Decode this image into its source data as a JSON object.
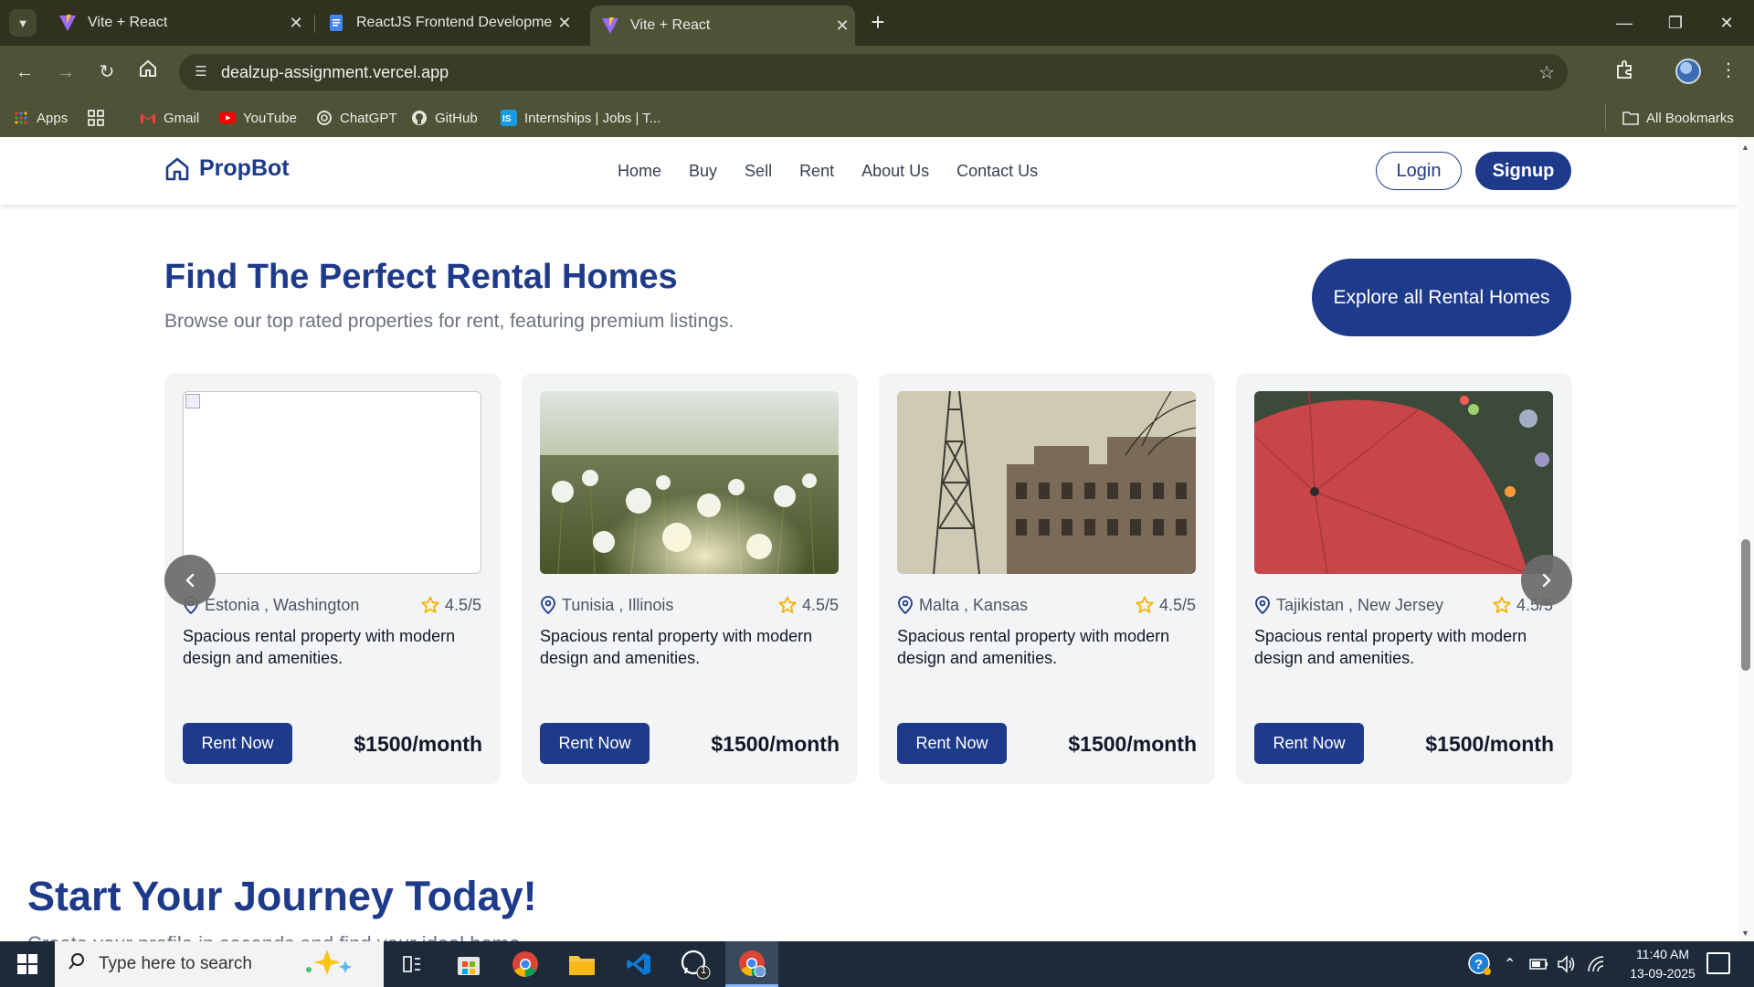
{
  "browser": {
    "tabs": [
      {
        "title": "Vite + React",
        "active": false
      },
      {
        "title": "ReactJS Frontend Development",
        "active": false
      },
      {
        "title": "Vite + React",
        "active": true
      }
    ],
    "url": "dealzup-assignment.vercel.app",
    "bookmarks": [
      {
        "label": "Apps",
        "icon": "apps-grid-icon"
      },
      {
        "label": "",
        "icon": "tab-groups-icon"
      },
      {
        "label": "Gmail",
        "icon": "gmail-icon"
      },
      {
        "label": "YouTube",
        "icon": "youtube-icon"
      },
      {
        "label": "ChatGPT",
        "icon": "chatgpt-icon"
      },
      {
        "label": "GitHub",
        "icon": "github-icon"
      },
      {
        "label": "Internships | Jobs | T...",
        "icon": "internshala-icon"
      }
    ],
    "all_bookmarks": "All Bookmarks"
  },
  "site": {
    "brand": "PropBot",
    "nav": [
      "Home",
      "Buy",
      "Sell",
      "Rent",
      "About Us",
      "Contact Us"
    ],
    "login": "Login",
    "signup": "Signup"
  },
  "rental": {
    "title": "Find The Perfect Rental Homes",
    "subtitle": "Browse our top rated properties for rent, featuring premium listings.",
    "explore": "Explore all Rental Homes",
    "cards": [
      {
        "location": "Estonia , Washington",
        "rating": "4.5/5",
        "description": "Spacious rental property with modern design and amenities.",
        "button": "Rent Now",
        "price": "$1500/month",
        "image": "broken-image"
      },
      {
        "location": "Tunisia , Illinois",
        "rating": "4.5/5",
        "description": "Spacious rental property with modern design and amenities.",
        "button": "Rent Now",
        "price": "$1500/month",
        "image": "dandelion-field"
      },
      {
        "location": "Malta , Kansas",
        "rating": "4.5/5",
        "description": "Spacious rental property with modern design and amenities.",
        "button": "Rent Now",
        "price": "$1500/month",
        "image": "eiffel-tower-street"
      },
      {
        "location": "Tajikistan , New Jersey",
        "rating": "4.5/5",
        "description": "Spacious rental property with modern design and amenities.",
        "button": "Rent Now",
        "price": "$1500/month",
        "image": "red-umbrella"
      }
    ]
  },
  "journey": {
    "title": "Start Your Journey Today!",
    "subtitle": "Create your profile in seconds and find your ideal home."
  },
  "taskbar": {
    "search_placeholder": "Type here to search",
    "time": "11:40 AM",
    "date": "13-09-2025",
    "whatsapp_badge": "1"
  },
  "colors": {
    "brand": "#1e3a8a",
    "card_bg": "#f3f4f6",
    "chrome_frame": "#4e5236",
    "star": "#f5b301"
  }
}
